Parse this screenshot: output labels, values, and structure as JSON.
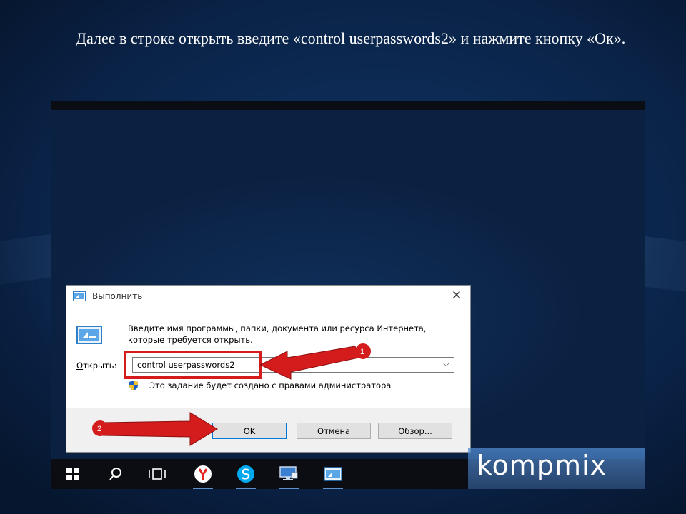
{
  "instruction": "Далее в строке открыть введите «control userpasswords2» и нажмите кнопку «Ок».",
  "colors": {
    "highlight": "#d41c1c",
    "accent": "#0078d7",
    "taskbar": "#0b0d13"
  },
  "run_dialog": {
    "title": "Выполнить",
    "description": "Введите имя программы, папки, документа или ресурса Интернета, которые требуется открыть.",
    "open_label_accel": "О",
    "open_label_rest": "ткрыть:",
    "open_value": "control userpasswords2",
    "admin_note": "Это задание будет создано с правами администратора",
    "buttons": {
      "ok": "OK",
      "cancel": "Отмена",
      "browse": "Обзор..."
    },
    "icons": [
      "run-app-icon",
      "close-icon",
      "chevron-down-icon",
      "uac-shield-icon"
    ]
  },
  "steps": {
    "step1": "1",
    "step2": "2"
  },
  "taskbar": {
    "items": [
      "windows-start-icon",
      "search-icon",
      "task-view-icon",
      "yandex-browser-icon",
      "skype-icon",
      "network-computer-icon",
      "run-app-icon"
    ]
  },
  "watermark": "kompmix"
}
